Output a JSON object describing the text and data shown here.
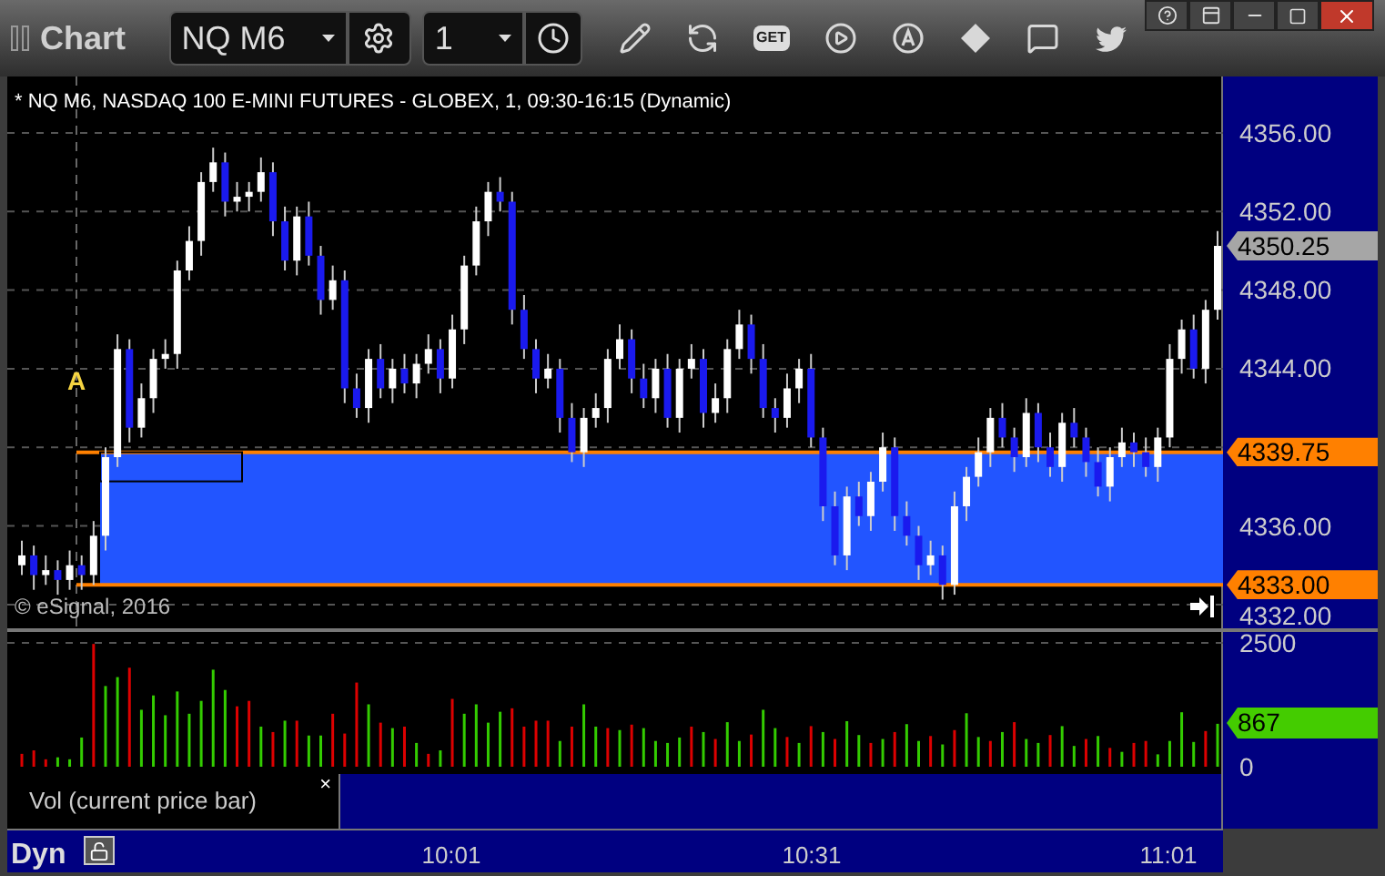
{
  "window": {
    "title": "Chart"
  },
  "toolbar": {
    "symbol": "NQ M6",
    "interval": "1",
    "get_label": "GET"
  },
  "chart": {
    "title": "* NQ M6, NASDAQ 100 E-MINI FUTURES - GLOBEX, 1, 09:30-16:15 (Dynamic)",
    "marker": "A",
    "copyright": "© eSignal, 2016",
    "price_labels": [
      {
        "text": "4350.25",
        "color": "#a6a6a6"
      },
      {
        "text": "4339.75",
        "color": "#ff8000"
      },
      {
        "text": "4333.00",
        "color": "#ff8000"
      }
    ],
    "chart_data": {
      "type": "candlestick",
      "ylim": [
        4330.79,
        4358.87
      ],
      "yticks": [
        {
          "value": 4356,
          "label": "4356.00"
        },
        {
          "value": 4352,
          "label": "4352.00"
        },
        {
          "value": 4348,
          "label": "4348.00"
        },
        {
          "value": 4344,
          "label": "4344.00"
        },
        {
          "value": 4336,
          "label": "4336.00"
        },
        {
          "value": 4332,
          "label": "4332.00"
        }
      ],
      "grid": true,
      "ref_lines": [
        {
          "axis": "y",
          "value": 4339.75,
          "color": "#ff8000"
        },
        {
          "axis": "y",
          "value": 4333,
          "color": "#ff8000"
        }
      ],
      "bands": [
        {
          "axis": "y",
          "from": 4333,
          "to": 4339.75,
          "color": "#2255ff"
        }
      ],
      "ohlc": [
        [
          4334,
          4335.25,
          4333.5,
          4334.5
        ],
        [
          4334.5,
          4335,
          4332.75,
          4333.5
        ],
        [
          4333.5,
          4334.5,
          4333,
          4333.75
        ],
        [
          4333.75,
          4334.25,
          4332.5,
          4333.25
        ],
        [
          4333.25,
          4334.75,
          4332.75,
          4334
        ],
        [
          4334,
          4334.5,
          4332.75,
          4333.5
        ],
        [
          4333.5,
          4336.25,
          4333,
          4335.5
        ],
        [
          4335.5,
          4340,
          4334.75,
          4339.5
        ],
        [
          4339.5,
          4345.75,
          4339,
          4345
        ],
        [
          4345,
          4345.5,
          4340.25,
          4341
        ],
        [
          4341,
          4343.25,
          4340.5,
          4342.5
        ],
        [
          4342.5,
          4345,
          4341.75,
          4344.5
        ],
        [
          4344.5,
          4345.5,
          4344,
          4344.75
        ],
        [
          4344.75,
          4349.5,
          4344,
          4349
        ],
        [
          4349,
          4351.25,
          4348.5,
          4350.5
        ],
        [
          4350.5,
          4354,
          4349.75,
          4353.5
        ],
        [
          4353.5,
          4355.25,
          4353,
          4354.5
        ],
        [
          4354.5,
          4355,
          4351.75,
          4352.5
        ],
        [
          4352.5,
          4353.5,
          4352,
          4352.75
        ],
        [
          4352.75,
          4353.5,
          4352,
          4353
        ],
        [
          4353,
          4354.75,
          4352.5,
          4354
        ],
        [
          4354,
          4354.5,
          4350.75,
          4351.5
        ],
        [
          4351.5,
          4352.25,
          4349,
          4349.5
        ],
        [
          4349.5,
          4352.25,
          4348.75,
          4351.75
        ],
        [
          4351.75,
          4352.5,
          4349.25,
          4349.75
        ],
        [
          4349.75,
          4350.25,
          4346.75,
          4347.5
        ],
        [
          4347.5,
          4349.25,
          4347,
          4348.5
        ],
        [
          4348.5,
          4349,
          4342.25,
          4343
        ],
        [
          4343,
          4343.75,
          4341.5,
          4342
        ],
        [
          4342,
          4345,
          4341.25,
          4344.5
        ],
        [
          4344.5,
          4345.25,
          4342.5,
          4343
        ],
        [
          4343,
          4344.5,
          4342.25,
          4344
        ],
        [
          4344,
          4344.75,
          4342.75,
          4343.25
        ],
        [
          4343.25,
          4344.75,
          4342.5,
          4344.25
        ],
        [
          4344.25,
          4345.75,
          4343.75,
          4345
        ],
        [
          4345,
          4345.5,
          4342.75,
          4343.5
        ],
        [
          4343.5,
          4346.75,
          4343,
          4346
        ],
        [
          4346,
          4349.75,
          4345.25,
          4349.25
        ],
        [
          4349.25,
          4352.25,
          4348.75,
          4351.5
        ],
        [
          4351.5,
          4353.5,
          4350.75,
          4353
        ],
        [
          4353,
          4353.75,
          4352,
          4352.5
        ],
        [
          4352.5,
          4353,
          4346.25,
          4347
        ],
        [
          4347,
          4347.75,
          4344.5,
          4345
        ],
        [
          4345,
          4345.5,
          4342.75,
          4343.5
        ],
        [
          4343.5,
          4344.75,
          4343,
          4344
        ],
        [
          4344,
          4344.5,
          4340.75,
          4341.5
        ],
        [
          4341.5,
          4342.25,
          4339.25,
          4339.75
        ],
        [
          4339.75,
          4342,
          4339,
          4341.5
        ],
        [
          4341.5,
          4342.75,
          4341,
          4342
        ],
        [
          4342,
          4345,
          4341.25,
          4344.5
        ],
        [
          4344.5,
          4346.25,
          4344,
          4345.5
        ],
        [
          4345.5,
          4346,
          4342.75,
          4343.5
        ],
        [
          4343.5,
          4344.25,
          4342,
          4342.5
        ],
        [
          4342.5,
          4344.5,
          4341.75,
          4344
        ],
        [
          4344,
          4344.75,
          4341,
          4341.5
        ],
        [
          4341.5,
          4344.5,
          4340.75,
          4344
        ],
        [
          4344,
          4345.25,
          4343.5,
          4344.5
        ],
        [
          4344.5,
          4345,
          4341,
          4341.75
        ],
        [
          4341.75,
          4343.25,
          4341.25,
          4342.5
        ],
        [
          4342.5,
          4345.5,
          4341.75,
          4345
        ],
        [
          4345,
          4347,
          4344.5,
          4346.25
        ],
        [
          4346.25,
          4346.75,
          4343.75,
          4344.5
        ],
        [
          4344.5,
          4345.25,
          4341.5,
          4342
        ],
        [
          4342,
          4342.5,
          4340.75,
          4341.5
        ],
        [
          4341.5,
          4343.75,
          4341,
          4343
        ],
        [
          4343,
          4344.5,
          4342.25,
          4344
        ],
        [
          4344,
          4344.75,
          4340,
          4340.5
        ],
        [
          4340.5,
          4341,
          4336.25,
          4337
        ],
        [
          4337,
          4337.75,
          4334,
          4334.5
        ],
        [
          4334.5,
          4338,
          4333.75,
          4337.5
        ],
        [
          4337.5,
          4338.25,
          4336,
          4336.5
        ],
        [
          4336.5,
          4338.75,
          4335.75,
          4338.25
        ],
        [
          4338.25,
          4340.75,
          4337.75,
          4340
        ],
        [
          4340,
          4340.5,
          4335.75,
          4336.5
        ],
        [
          4336.5,
          4337.25,
          4335,
          4335.5
        ],
        [
          4335.5,
          4336,
          4333.25,
          4334
        ],
        [
          4334,
          4335.25,
          4333.5,
          4334.5
        ],
        [
          4334.5,
          4335,
          4332.25,
          4333
        ],
        [
          4333,
          4337.75,
          4332.5,
          4337
        ],
        [
          4337,
          4339,
          4336.25,
          4338.5
        ],
        [
          4338.5,
          4340.5,
          4338,
          4339.75
        ],
        [
          4339.75,
          4342,
          4339,
          4341.5
        ],
        [
          4341.5,
          4342.25,
          4340,
          4340.5
        ],
        [
          4340.5,
          4341,
          4338.75,
          4339.5
        ],
        [
          4339.5,
          4342.5,
          4339,
          4341.75
        ],
        [
          4341.75,
          4342.25,
          4339.25,
          4340
        ],
        [
          4340,
          4340.75,
          4338.5,
          4339
        ],
        [
          4339,
          4341.75,
          4338.25,
          4341.25
        ],
        [
          4341.25,
          4342,
          4340,
          4340.5
        ],
        [
          4340.5,
          4341,
          4338.5,
          4339.25
        ],
        [
          4339.25,
          4340,
          4337.5,
          4338
        ],
        [
          4338,
          4340,
          4337.25,
          4339.5
        ],
        [
          4339.5,
          4341,
          4339,
          4340.25
        ],
        [
          4340.25,
          4340.75,
          4339,
          4339.75
        ],
        [
          4339.75,
          4340.5,
          4338.5,
          4339
        ],
        [
          4339,
          4341,
          4338.25,
          4340.5
        ],
        [
          4340.5,
          4345.25,
          4340,
          4344.5
        ],
        [
          4344.5,
          4346.5,
          4343.75,
          4346
        ],
        [
          4346,
          4346.75,
          4343.5,
          4344
        ],
        [
          4344,
          4347.5,
          4343.25,
          4347
        ],
        [
          4347,
          4351,
          4346.5,
          4350.25
        ]
      ]
    }
  },
  "volume": {
    "current_label": "867",
    "chart_data": {
      "type": "bar",
      "ylim": [
        0,
        2700
      ],
      "yticks": [
        2500,
        0
      ],
      "grid": true,
      "series": [
        {
          "color": "#33cc00",
          "values": [
            null,
            null,
            null,
            190,
            150,
            590,
            null,
            1630,
            1810,
            null,
            1150,
            1440,
            1040,
            1520,
            1070,
            1330,
            1960,
            1550,
            null,
            null,
            810,
            null,
            930,
            null,
            630,
            630,
            null,
            null,
            null,
            1260,
            null,
            780,
            null,
            480,
            null,
            330,
            null,
            1070,
            1260,
            890,
            1110,
            null,
            null,
            null,
            null,
            520,
            null,
            1260,
            810,
            null,
            740,
            null,
            780,
            520,
            480,
            590,
            null,
            700,
            null,
            900,
            520,
            null,
            1150,
            780,
            null,
            480,
            null,
            700,
            null,
            920,
            640,
            null,
            560,
            null,
            860,
            520,
            null,
            450,
            null,
            1080,
            600,
            null,
            700,
            null,
            560,
            480,
            null,
            820,
            420,
            null,
            620,
            null,
            300,
            null,
            null,
            250,
            520,
            1100,
            500,
            null,
            867
          ]
        },
        {
          "color": "#dd0000",
          "values": [
            260,
            330,
            150,
            null,
            null,
            null,
            2480,
            null,
            null,
            2000,
            null,
            null,
            null,
            null,
            null,
            null,
            null,
            null,
            1220,
            1330,
            null,
            700,
            null,
            930,
            null,
            null,
            1070,
            670,
            1700,
            null,
            890,
            null,
            810,
            null,
            260,
            null,
            1370,
            null,
            null,
            null,
            null,
            1180,
            810,
            930,
            930,
            null,
            810,
            null,
            null,
            780,
            null,
            850,
            null,
            null,
            null,
            null,
            810,
            null,
            560,
            null,
            null,
            650,
            null,
            null,
            600,
            null,
            820,
            null,
            560,
            null,
            null,
            480,
            null,
            700,
            null,
            null,
            620,
            null,
            740,
            null,
            null,
            520,
            null,
            900,
            null,
            null,
            640,
            null,
            null,
            560,
            null,
            380,
            null,
            480,
            520,
            null,
            null,
            null,
            null,
            720,
            null
          ]
        }
      ]
    }
  },
  "legend": {
    "label": "Vol (current price bar)",
    "close": "×"
  },
  "time_axis": {
    "mode": "Dyn",
    "labels": [
      "10:01",
      "10:31",
      "11:01"
    ]
  }
}
